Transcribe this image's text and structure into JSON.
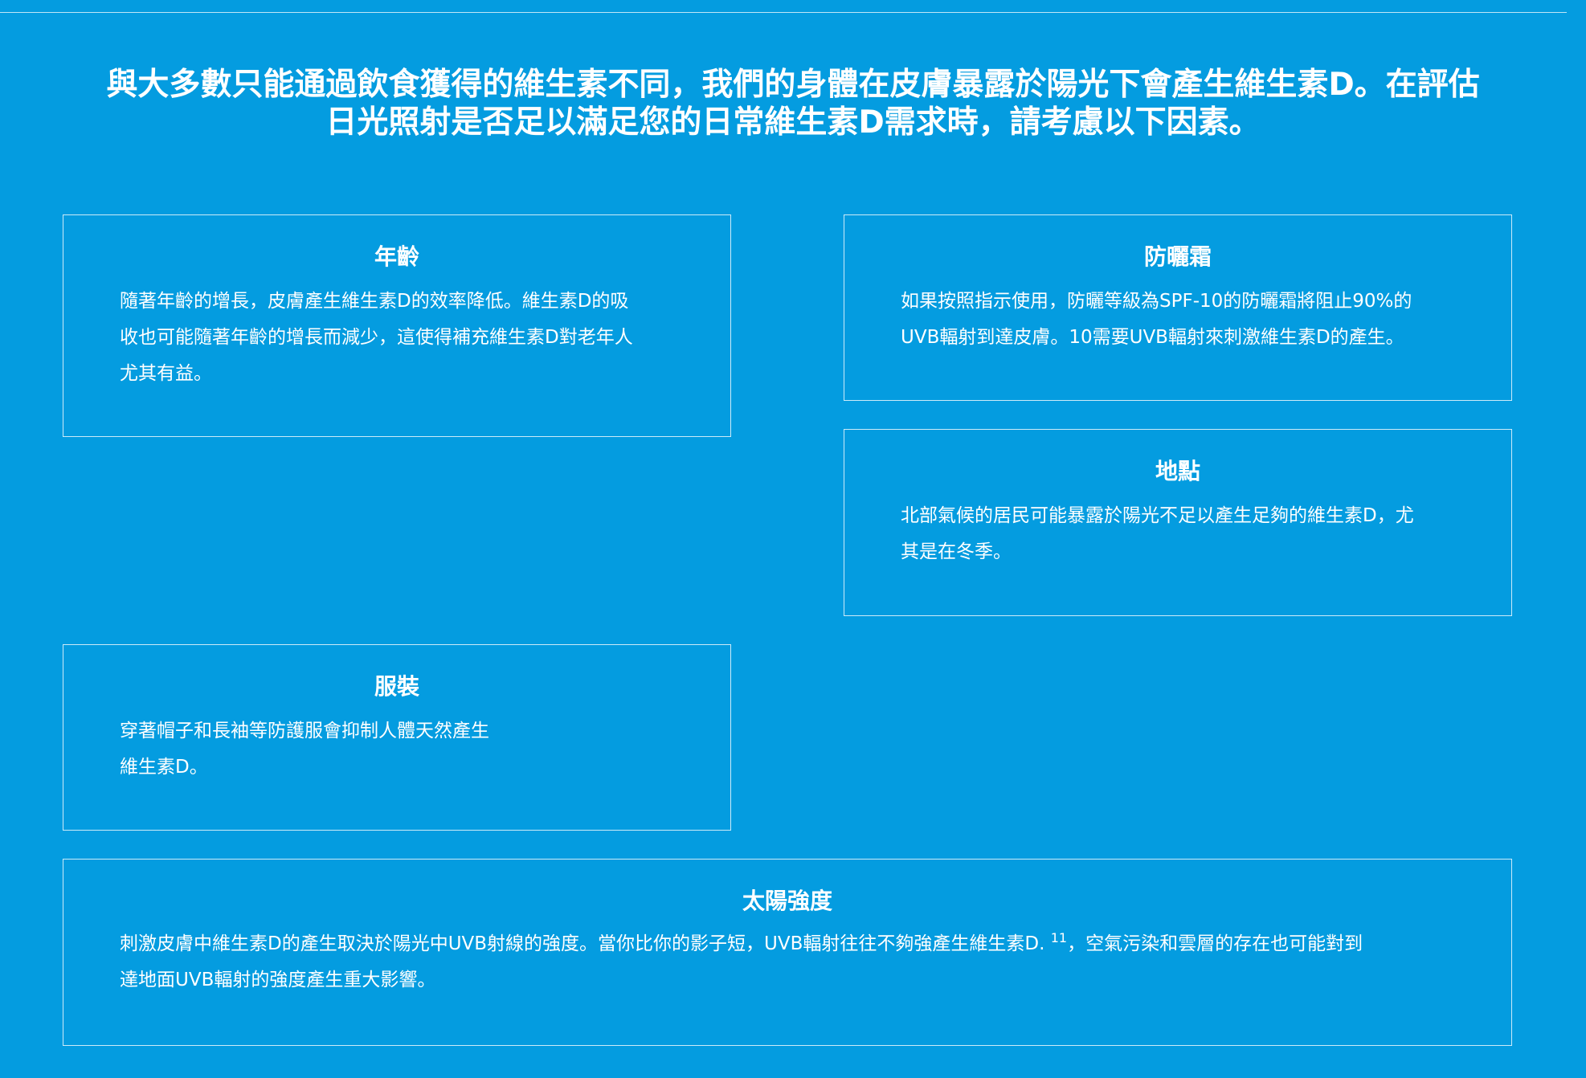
{
  "intro": {
    "line1": "與大多數只能通過飲食獲得的維生素不同，我們的身體在皮膚暴露於陽光下會產生維生素D。在評估",
    "line2": "日光照射是否足以滿足您的日常維生素D需求時，請考慮以下因素。"
  },
  "cards": {
    "age": {
      "title": "年齡",
      "line1": "隨著年齡的增長，皮膚產生維生素D的效率降低。維生素D的吸",
      "line2": "收也可能隨著年齡的增長而減少，這使得補充維生素D對老年人",
      "line3": "尤其有益。"
    },
    "sunscreen": {
      "title": "防曬霜",
      "line1": "如果按照指示使用，防曬等級為SPF-10的防曬霜將阻止90%的",
      "line2": "UVB輻射到達皮膚。10需要UVB輻射來刺激維生素D的產生。"
    },
    "location": {
      "title": "地點",
      "line1": "北部氣候的居民可能暴露於陽光不足以產生足夠的維生素D，尤",
      "line2": "其是在冬季。"
    },
    "clothing": {
      "title": "服裝",
      "line1": "穿著帽子和長袖等防護服會抑制人體天然產生",
      "line2": "維生素D。"
    },
    "sun_intensity": {
      "title": "太陽強度",
      "line1_a": "刺激皮膚中維生素D的產生取決於陽光中UVB射線的強度。當你比你的影子短，UVB輻射往往不夠強產生維生素D.",
      "footnote": "11",
      "line1_b": "，空氣污染和雲層的存在也可能對到",
      "line2": "達地面UVB輻射的強度產生重大影響。"
    }
  }
}
